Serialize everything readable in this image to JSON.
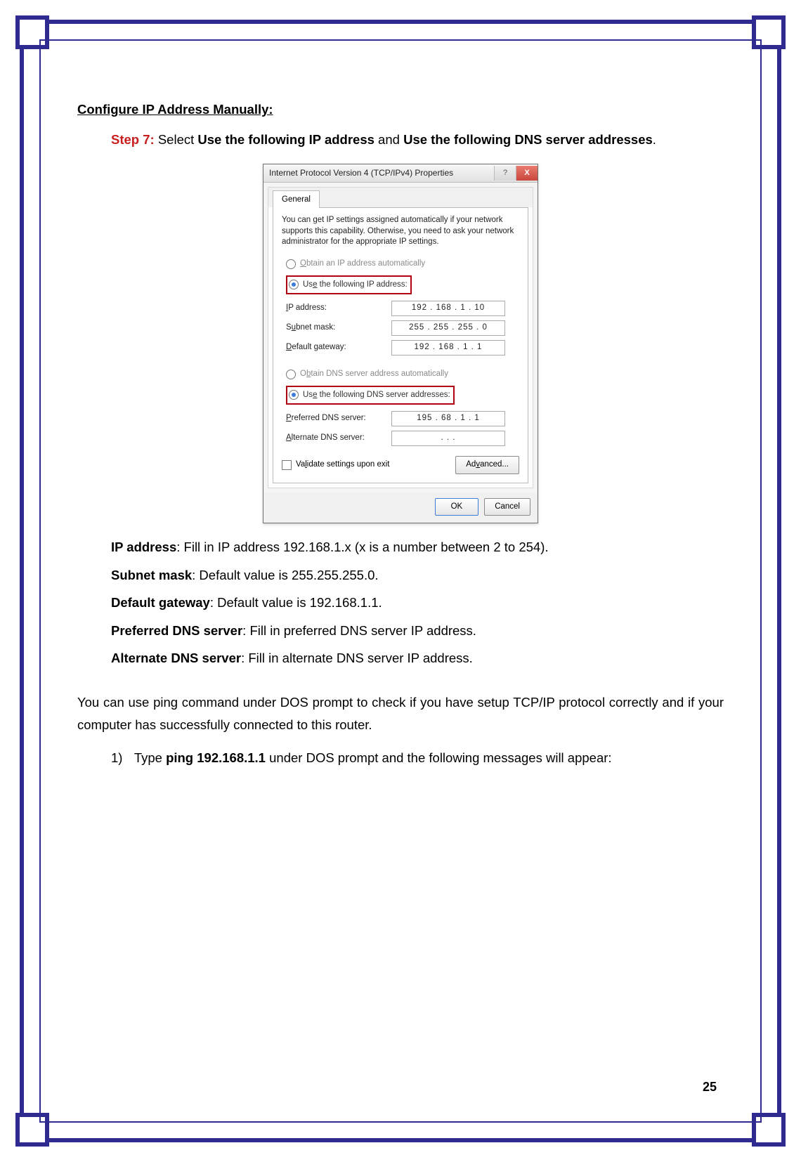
{
  "page": {
    "heading": "Configure IP Address Manually",
    "number": "25"
  },
  "step": {
    "label": "Step 7:",
    "text_a": "Select ",
    "b1": "Use the following IP address",
    "mid": " and ",
    "b2": "Use the following DNS server addresses",
    "tail": "."
  },
  "dialog": {
    "title": "Internet Protocol Version 4 (TCP/IPv4) Properties",
    "help": "?",
    "close": "X",
    "tab": "General",
    "desc": "You can get IP settings assigned automatically if your network supports this capability. Otherwise, you need to ask your network administrator for the appropriate IP settings.",
    "obtain_ip": "Obtain an IP address automatically",
    "use_ip": "Use the following IP address:",
    "ip_lbl": "IP address:",
    "ip_val": "192 . 168 .   1   .  10",
    "mask_lbl": "Subnet mask:",
    "mask_val": "255 . 255 . 255 .   0",
    "gw_lbl": "Default gateway:",
    "gw_val": "192 . 168 .   1   .   1",
    "obtain_dns": "Obtain DNS server address automatically",
    "use_dns": "Use the following DNS server addresses:",
    "pdns_lbl": "Preferred DNS server:",
    "pdns_val": "195 .  68  .   1   .   1",
    "adns_lbl": "Alternate DNS server:",
    "adns_val": ".       .       .",
    "validate": "Validate settings upon exit",
    "advanced": "Advanced...",
    "ok": "OK",
    "cancel": "Cancel"
  },
  "fields": {
    "ip": {
      "l": "IP address",
      "t": ": Fill in IP address 192.168.1.x (x is a number between 2 to 254)."
    },
    "mask": {
      "l": "Subnet mask",
      "t": ": Default value is 255.255.255.0."
    },
    "gw": {
      "l": "Default gateway",
      "t": ": Default value is 192.168.1.1."
    },
    "pdns": {
      "l": "Preferred DNS server",
      "t": ": Fill in preferred DNS server IP address."
    },
    "adns": {
      "l": "Alternate DNS server",
      "t": ": Fill in alternate DNS server IP address."
    }
  },
  "para": "You can use ping command under DOS prompt to check if you have setup TCP/IP protocol correctly and if your computer has successfully connected to this router.",
  "list1": {
    "num": "1)",
    "a": "Type ",
    "cmd": "ping 192.168.1.1",
    "b": " under DOS prompt and the following messages will appear:"
  }
}
